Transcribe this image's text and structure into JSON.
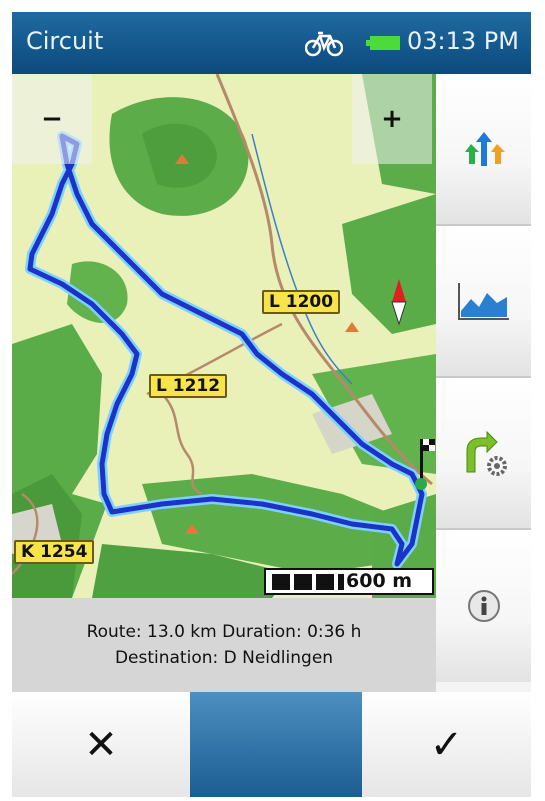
{
  "status": {
    "title": "Circuit",
    "time": "03:13 PM",
    "icons": [
      "bicycle-icon",
      "battery-icon"
    ]
  },
  "map": {
    "zoom_out_label": "−",
    "zoom_in_label": "+",
    "road_labels": [
      "L 1200",
      "L 1212",
      "K 1254"
    ],
    "scale_label": "600 m",
    "icons": [
      "compass-icon",
      "finish-flag-icon",
      "peak-marker-icon"
    ]
  },
  "info": {
    "route_line": "Route: 13.0 km Duration: 0:36 h",
    "destination_line": "Destination: D Neidlingen"
  },
  "sidebar": {
    "buttons": [
      {
        "icon": "route-options-icon"
      },
      {
        "icon": "elevation-profile-icon"
      },
      {
        "icon": "route-settings-icon"
      },
      {
        "icon": "info-icon"
      }
    ]
  },
  "bottombar": {
    "cancel_label": "✕",
    "ok_label": "✓"
  },
  "colors": {
    "header_blue": "#0d4a7d",
    "route_blue": "#1a33c8",
    "forest_green": "#59b045",
    "road_label_yellow": "#f7e34a"
  }
}
